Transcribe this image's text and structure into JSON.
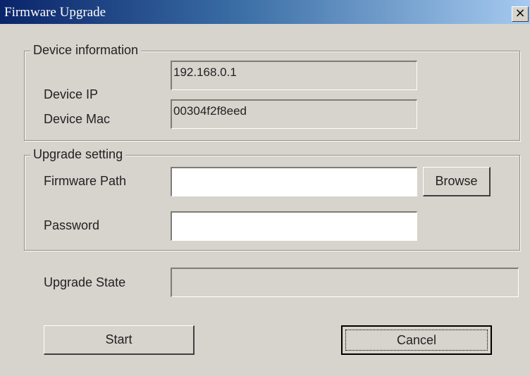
{
  "window": {
    "title": "Firmware Upgrade",
    "close_glyph": "×",
    "close_icon": "close-icon"
  },
  "device_info": {
    "legend": "Device information",
    "ip_label": "Device IP",
    "ip_value": "192.168.0.1",
    "mac_label": "Device Mac",
    "mac_value": "00304f2f8eed"
  },
  "upgrade_setting": {
    "legend": "Upgrade setting",
    "path_label": "Firmware Path",
    "path_value": "",
    "browse_label": "Browse",
    "password_label": "Password",
    "password_value": ""
  },
  "upgrade_state": {
    "label": "Upgrade State",
    "value": ""
  },
  "actions": {
    "start_label": "Start",
    "cancel_label": "Cancel"
  },
  "colors": {
    "dialog_bg": "#d7d3cd",
    "titlebar_start": "#0a246a",
    "titlebar_end": "#a6caf0",
    "title_text": "#ffffff"
  }
}
